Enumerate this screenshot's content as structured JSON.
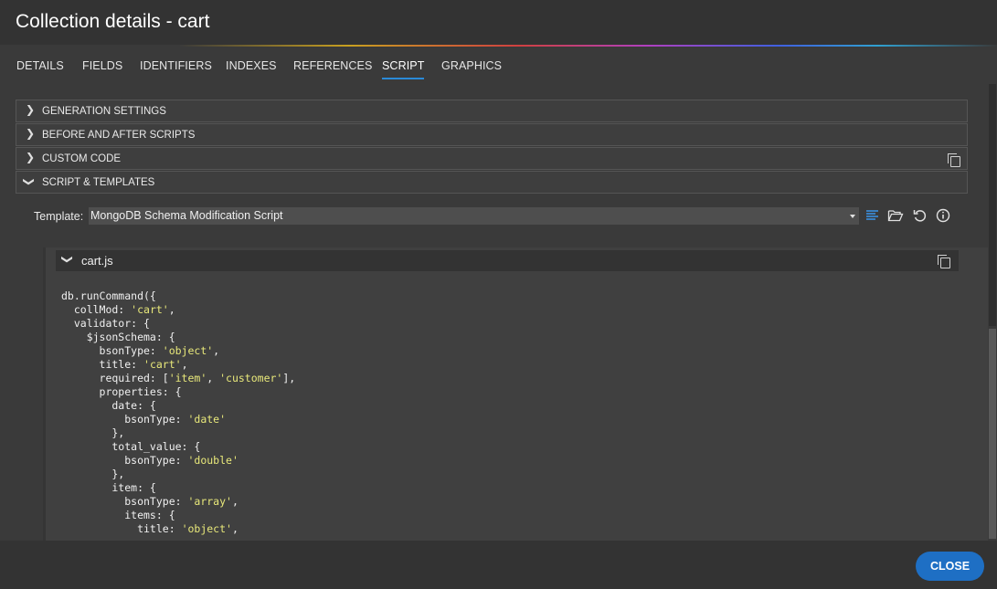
{
  "window": {
    "title": "Collection details - cart"
  },
  "tabs": [
    {
      "label": "DETAILS"
    },
    {
      "label": "FIELDS"
    },
    {
      "label": "IDENTIFIERS"
    },
    {
      "label": "INDEXES"
    },
    {
      "label": "REFERENCES"
    },
    {
      "label": "SCRIPT",
      "active": true
    },
    {
      "label": "GRAPHICS"
    }
  ],
  "accordion": [
    {
      "label": "GENERATION SETTINGS",
      "expanded": false
    },
    {
      "label": "BEFORE AND AFTER SCRIPTS",
      "expanded": false
    },
    {
      "label": "CUSTOM CODE",
      "expanded": false
    },
    {
      "label": "SCRIPT & TEMPLATES",
      "expanded": true
    }
  ],
  "template": {
    "label": "Template:",
    "selected": "MongoDB Schema Modification Script",
    "icons": [
      "format-icon",
      "folder-open-icon",
      "reset-icon",
      "info-icon"
    ]
  },
  "file": {
    "name": "cart.js"
  },
  "code_lines": [
    [
      [
        "db.runCommand({",
        ""
      ]
    ],
    [
      [
        "  collMod: ",
        ""
      ],
      [
        "'cart'",
        "s"
      ],
      [
        ",",
        ""
      ]
    ],
    [
      [
        "  validator: {",
        ""
      ]
    ],
    [
      [
        "    $jsonSchema: {",
        ""
      ]
    ],
    [
      [
        "      bsonType: ",
        ""
      ],
      [
        "'object'",
        "s"
      ],
      [
        ",",
        ""
      ]
    ],
    [
      [
        "      title: ",
        ""
      ],
      [
        "'cart'",
        "s"
      ],
      [
        ",",
        ""
      ]
    ],
    [
      [
        "      required: [",
        ""
      ],
      [
        "'item'",
        "s"
      ],
      [
        ", ",
        ""
      ],
      [
        "'customer'",
        "s"
      ],
      [
        "],",
        ""
      ]
    ],
    [
      [
        "      properties: {",
        ""
      ]
    ],
    [
      [
        "        date: {",
        ""
      ]
    ],
    [
      [
        "          bsonType: ",
        ""
      ],
      [
        "'date'",
        "s"
      ]
    ],
    [
      [
        "        },",
        ""
      ]
    ],
    [
      [
        "        total_value: {",
        ""
      ]
    ],
    [
      [
        "          bsonType: ",
        ""
      ],
      [
        "'double'",
        "s"
      ]
    ],
    [
      [
        "        },",
        ""
      ]
    ],
    [
      [
        "        item: {",
        ""
      ]
    ],
    [
      [
        "          bsonType: ",
        ""
      ],
      [
        "'array'",
        "s"
      ],
      [
        ",",
        ""
      ]
    ],
    [
      [
        "          items: {",
        ""
      ]
    ],
    [
      [
        "            title: ",
        ""
      ],
      [
        "'object'",
        "s"
      ],
      [
        ",",
        ""
      ]
    ]
  ],
  "footer": {
    "close_label": "CLOSE"
  },
  "colors": {
    "accent": "#2a8ad8",
    "button": "#1e6fc4",
    "string": "#e8e87a"
  }
}
